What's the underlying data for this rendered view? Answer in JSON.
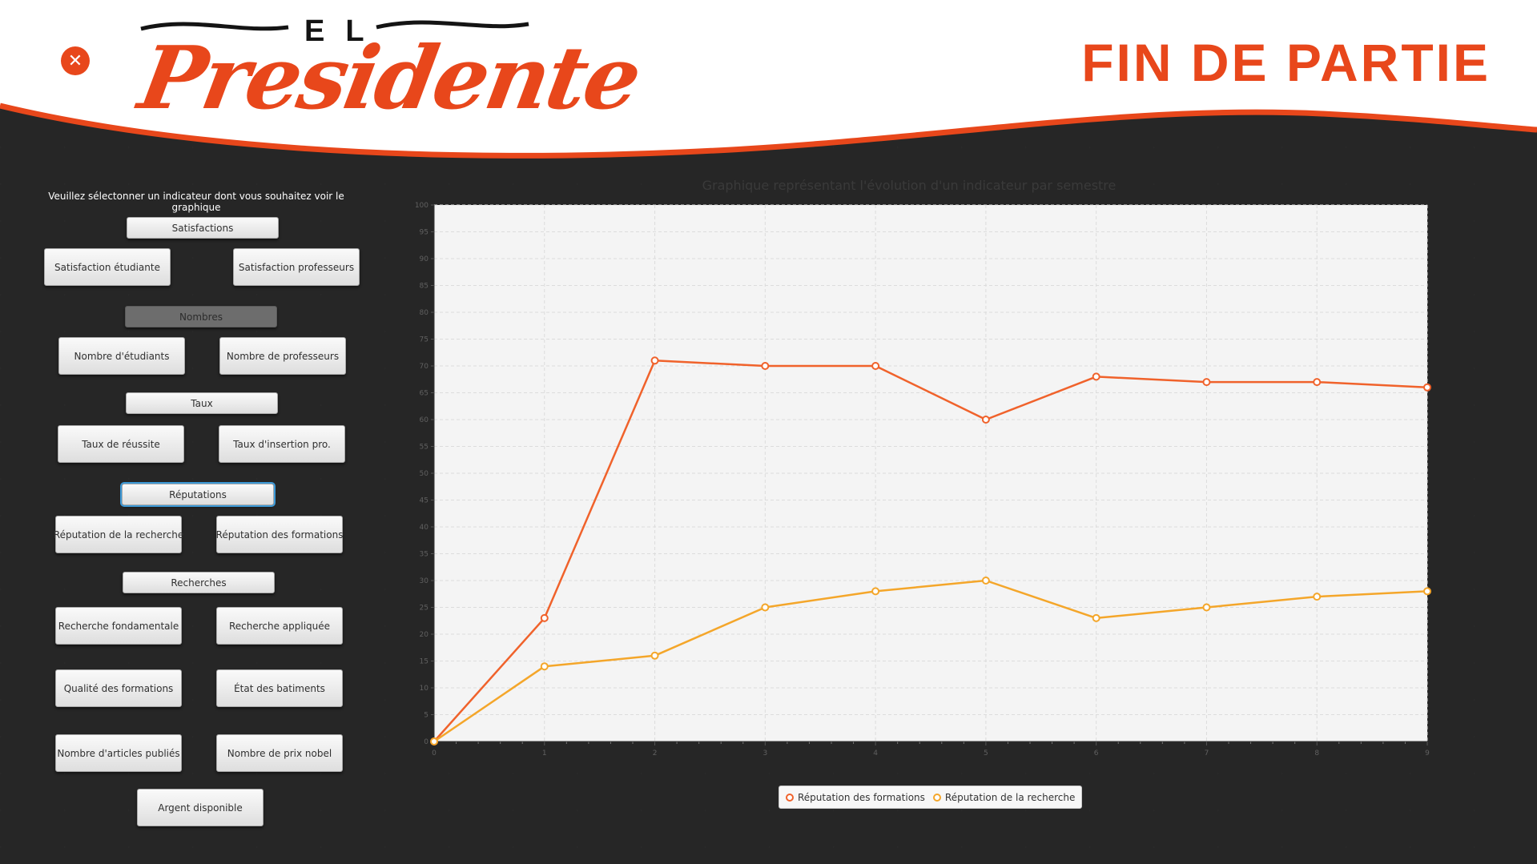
{
  "header": {
    "close_icon": "close-icon",
    "logo_top": "EL",
    "logo_main": "Presidente",
    "title": "FIN DE PARTIE"
  },
  "sidebar": {
    "instruction": "Veuillez sélectonner un indicateur dont vous souhaitez voir le graphique",
    "categories": {
      "satisfactions": "Satisfactions",
      "nombres": "Nombres",
      "taux": "Taux",
      "reputations": "Réputations",
      "recherches": "Recherches"
    },
    "indicators": {
      "satisfaction_etudiante": "Satisfaction étudiante",
      "satisfaction_professeurs": "Satisfaction professeurs",
      "nombre_etudiants": "Nombre d'étudiants",
      "nombre_professeurs": "Nombre de professeurs",
      "taux_reussite": "Taux de réussite",
      "taux_insertion": "Taux d'insertion pro.",
      "reputation_recherche": "Réputation de la recherche",
      "reputation_formations": "Réputation des formations",
      "recherche_fondamentale": "Recherche fondamentale",
      "recherche_appliquee": "Recherche appliquée",
      "qualite_formations": "Qualité des formations",
      "etat_batiments": "État des batiments",
      "nombre_articles": "Nombre d'articles publiés",
      "nombre_prix_nobel": "Nombre de prix nobel",
      "argent_disponible": "Argent disponible"
    }
  },
  "chart_title": "Graphique représentant l'évolution d'un indicateur par semestre",
  "colors": {
    "accent": "#e8471b",
    "series_formations": "#f0622b",
    "series_recherche": "#f4a62a",
    "plot_background": "#f4f4f4"
  },
  "chart_data": {
    "type": "line",
    "x": [
      0,
      1,
      2,
      3,
      4,
      5,
      6,
      7,
      8,
      9
    ],
    "xlim": [
      0,
      9
    ],
    "ylim": [
      0,
      100
    ],
    "yticks": [
      0,
      5,
      10,
      15,
      20,
      25,
      30,
      35,
      40,
      45,
      50,
      55,
      60,
      65,
      70,
      75,
      80,
      85,
      90,
      95,
      100
    ],
    "grid": true,
    "legend_position": "bottom-center",
    "series": [
      {
        "name": "Réputation des formations",
        "values": [
          0,
          23,
          71,
          70,
          70,
          60,
          68,
          67,
          67,
          66
        ]
      },
      {
        "name": "Réputation de la recherche",
        "values": [
          0,
          14,
          16,
          25,
          28,
          30,
          23,
          25,
          27,
          28
        ]
      }
    ]
  }
}
